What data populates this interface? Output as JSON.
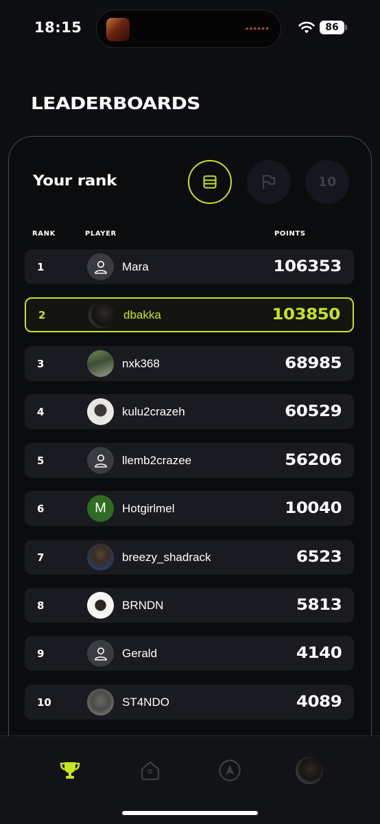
{
  "status_bar": {
    "time": "18:15",
    "battery": "86",
    "island_dots": "••••••"
  },
  "page": {
    "title": "LEADERBOARDS"
  },
  "card": {
    "heading": "Your rank",
    "filters": [
      {
        "icon": "list-icon",
        "active": true
      },
      {
        "icon": "flag-icon",
        "active": false
      },
      {
        "label": "10",
        "active": false
      }
    ],
    "columns": {
      "rank": "RANK",
      "player": "PLAYER",
      "points": "POINTS"
    }
  },
  "leaderboard": [
    {
      "rank": "1",
      "name": "Mara",
      "points": "106353",
      "avatar": "default"
    },
    {
      "rank": "2",
      "name": "dbakka",
      "points": "103850",
      "avatar": "photo",
      "highlight": true
    },
    {
      "rank": "3",
      "name": "nxk368",
      "points": "68985",
      "avatar": "photo"
    },
    {
      "rank": "4",
      "name": "kulu2crazeh",
      "points": "60529",
      "avatar": "photo"
    },
    {
      "rank": "5",
      "name": "llemb2crazee",
      "points": "56206",
      "avatar": "default"
    },
    {
      "rank": "6",
      "name": "Hotgirlmel",
      "points": "10040",
      "avatar": "letter",
      "avatar_letter": "M"
    },
    {
      "rank": "7",
      "name": "breezy_shadrack",
      "points": "6523",
      "avatar": "photo"
    },
    {
      "rank": "8",
      "name": "BRNDN",
      "points": "5813",
      "avatar": "photo"
    },
    {
      "rank": "9",
      "name": "Gerald",
      "points": "4140",
      "avatar": "default"
    },
    {
      "rank": "10",
      "name": "ST4NDO",
      "points": "4089",
      "avatar": "photo"
    }
  ],
  "bottom_nav": {
    "items": [
      {
        "icon": "trophy-icon",
        "active": true
      },
      {
        "icon": "home-icon",
        "badge": "0"
      },
      {
        "icon": "navigation-icon"
      },
      {
        "icon": "profile-avatar"
      }
    ]
  },
  "colors": {
    "accent": "#c8e41e",
    "background": "#0d0e11",
    "row": "#1a1b20"
  }
}
